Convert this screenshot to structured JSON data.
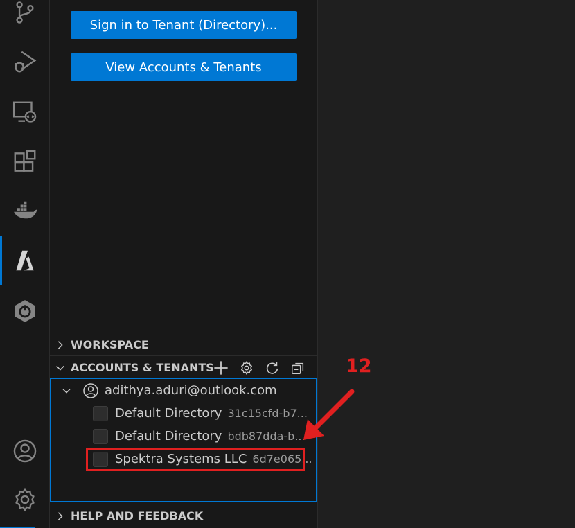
{
  "buttons": {
    "sign_in": "Sign in to Tenant (Directory)...",
    "view_accounts": "View Accounts & Tenants"
  },
  "sections": {
    "workspace": "WORKSPACE",
    "accounts": "ACCOUNTS & TENANTS",
    "help": "HELP AND FEEDBACK"
  },
  "account": {
    "email": "adithya.aduri@outlook.com",
    "tenants": [
      {
        "name": "Default Directory",
        "id": "31c15cfd-b7..."
      },
      {
        "name": "Default Directory",
        "id": "bdb87dda-b..."
      },
      {
        "name": "Spektra Systems LLC",
        "id": "6d7e065..."
      }
    ]
  },
  "annotation": {
    "step": "12"
  },
  "icons": {
    "activity_bar": [
      "source-control-icon",
      "run-debug-icon",
      "remote-explorer-icon",
      "extensions-icon",
      "docker-icon",
      "azure-icon",
      "spring-boot-icon",
      "account-icon",
      "settings-gear-icon"
    ],
    "accounts_actions": [
      "add-icon",
      "gear-icon",
      "refresh-icon",
      "collapse-all-icon"
    ]
  },
  "colors": {
    "accent": "#0078d4",
    "annotation": "#e02020"
  }
}
